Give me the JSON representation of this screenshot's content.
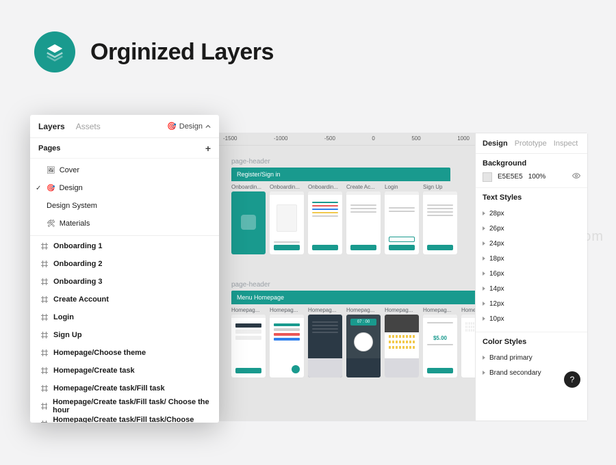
{
  "hero": {
    "title": "Orginized Layers"
  },
  "ghost": "om",
  "layers_panel": {
    "tabs": {
      "layers": "Layers",
      "assets": "Assets"
    },
    "page_selector": {
      "emoji": "🎯",
      "label": "Design"
    },
    "pages_header": "Pages",
    "pages": [
      {
        "emoji": "🖼",
        "label": "Cover",
        "active": false
      },
      {
        "emoji": "🎯",
        "label": "Design",
        "active": true
      },
      {
        "emoji": "",
        "label": "Design System",
        "active": false
      },
      {
        "emoji": "🛠",
        "label": "Materials",
        "active": false
      }
    ],
    "frames": [
      "Onboarding 1",
      "Onboarding 2",
      "Onboarding 3",
      "Create Account",
      "Login",
      "Sign Up",
      "Homepage/Choose theme",
      "Homepage/Create task",
      "Homepage/Create task/Fill task",
      "Homepage/Create task/Fill task/ Choose the hour",
      "Homepage/Create task/Fill task/Choose priority"
    ]
  },
  "canvas": {
    "ruler": [
      "-1500",
      "-1000",
      "-500",
      "0",
      "500",
      "1000"
    ],
    "section1": {
      "label": "page-header",
      "banner": "Register/Sign in",
      "thumbs": [
        "Onboardin...",
        "Onboardin...",
        "Onboardin...",
        "Create Ac...",
        "Login",
        "Sign Up"
      ]
    },
    "section2": {
      "label": "page-header",
      "banner": "Menu Homepage",
      "time": "07 : 00",
      "price": "$5.00",
      "thumbs": [
        "Homepag...",
        "Homepag...",
        "Homepag...",
        "Homepag...",
        "Homepag...",
        "Homepag...",
        "Homepa..."
      ]
    }
  },
  "inspect": {
    "tabs": {
      "design": "Design",
      "prototype": "Prototype",
      "inspect": "Inspect"
    },
    "background": {
      "header": "Background",
      "hex": "E5E5E5",
      "opacity": "100%"
    },
    "text_styles": {
      "header": "Text Styles",
      "items": [
        "28px",
        "26px",
        "24px",
        "18px",
        "16px",
        "14px",
        "12px",
        "10px"
      ]
    },
    "color_styles": {
      "header": "Color Styles",
      "items": [
        "Brand primary",
        "Brand secondary"
      ]
    },
    "help": "?"
  }
}
